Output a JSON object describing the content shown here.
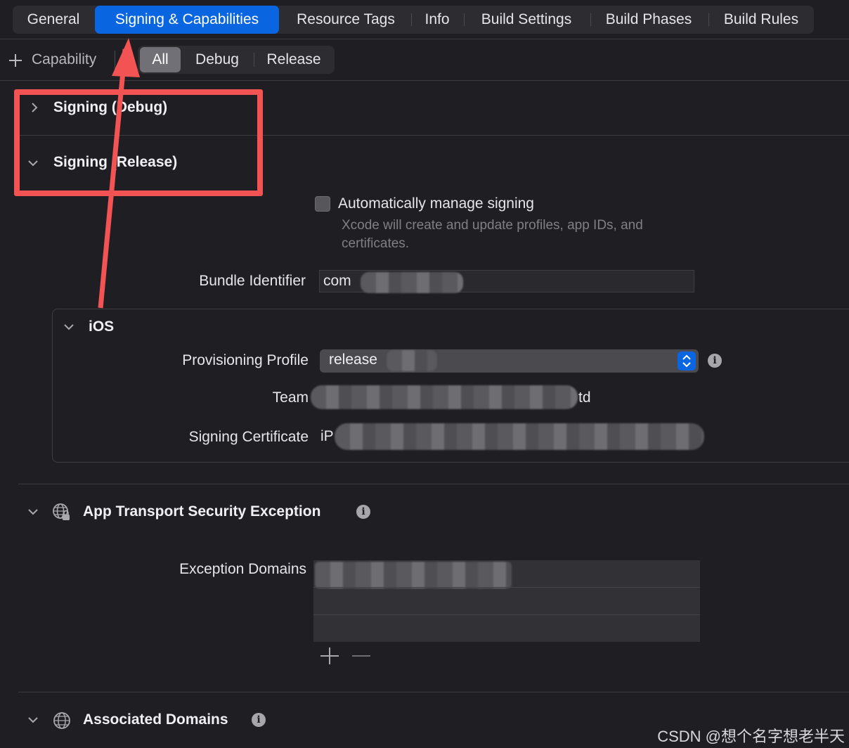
{
  "tabs": [
    {
      "label": "General"
    },
    {
      "label": "Signing & Capabilities"
    },
    {
      "label": "Resource Tags"
    },
    {
      "label": "Info"
    },
    {
      "label": "Build Settings"
    },
    {
      "label": "Build Phases"
    },
    {
      "label": "Build Rules"
    }
  ],
  "toolbar": {
    "capability_label": "Capability",
    "filters": [
      "All",
      "Debug",
      "Release"
    ]
  },
  "sections": {
    "signing_debug": "Signing (Debug)",
    "signing_release": "Signing (Release)"
  },
  "signing": {
    "auto_manage_label": "Automatically manage signing",
    "auto_manage_hint_line1": "Xcode will create and update profiles, app IDs, and",
    "auto_manage_hint_line2": "certificates.",
    "bundle_id_label": "Bundle Identifier",
    "bundle_id_value": "com",
    "ios_title": "iOS",
    "provisioning_label": "Provisioning Profile",
    "provisioning_value": "release",
    "team_label": "Team",
    "team_value_suffix": "td",
    "certificate_label": "Signing Certificate",
    "certificate_value": "iP"
  },
  "ats": {
    "title": "App Transport Security Exception",
    "domains_label": "Exception Domains"
  },
  "associated": {
    "title": "Associated Domains"
  },
  "watermark": "CSDN @想个名字想老半天",
  "colors": {
    "accent": "#0a66e0",
    "annotation_red": "#f45354",
    "background": "#1f1f23"
  }
}
